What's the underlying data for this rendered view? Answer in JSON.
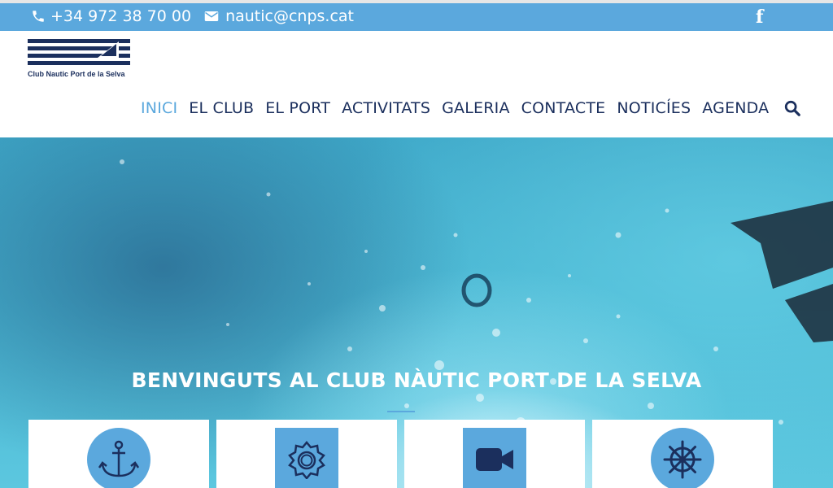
{
  "topbar": {
    "phone": "+34 972 38 70 00",
    "email": "nautic@cnps.cat",
    "facebook_icon": "facebook-icon"
  },
  "logo": {
    "text": "Club Nautic Port de la Selva"
  },
  "nav": {
    "items": [
      {
        "label": "INICI",
        "active": true
      },
      {
        "label": "EL CLUB",
        "active": false
      },
      {
        "label": "EL PORT",
        "active": false
      },
      {
        "label": "ACTIVITATS",
        "active": false
      },
      {
        "label": "GALERIA",
        "active": false
      },
      {
        "label": "CONTACTE",
        "active": false
      },
      {
        "label": "NOTICÍES",
        "active": false
      },
      {
        "label": "AGENDA",
        "active": false
      }
    ],
    "search_icon": "search-icon"
  },
  "hero": {
    "title": "BENVINGUTS AL CLUB NÀUTIC PORT DE LA SELVA"
  },
  "cards": [
    {
      "icon": "anchor-icon"
    },
    {
      "icon": "sun-gear-icon"
    },
    {
      "icon": "video-camera-icon"
    },
    {
      "icon": "ship-wheel-icon"
    }
  ],
  "colors": {
    "accent": "#5ba8dd",
    "navy": "#1b2f5d"
  }
}
